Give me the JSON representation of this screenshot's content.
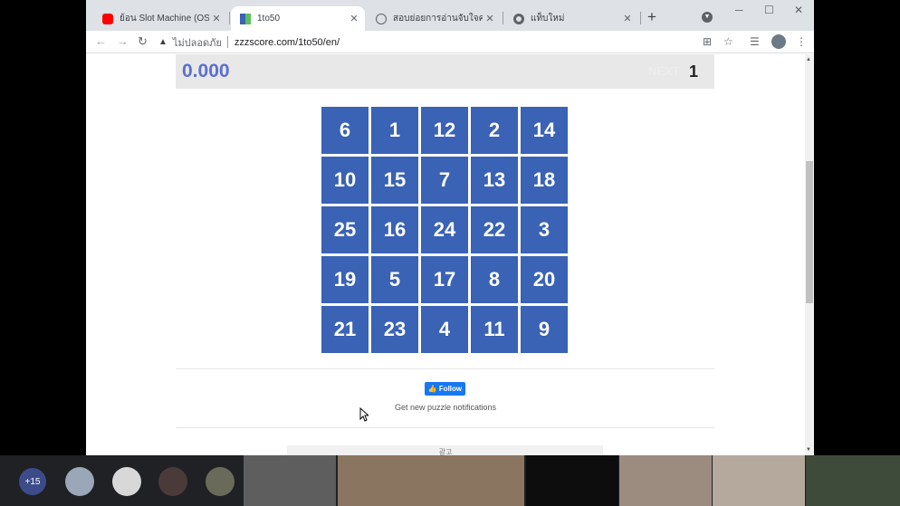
{
  "tabs": [
    {
      "title": "ย้อน Slot Machine (OST. Ho",
      "favicon": "youtube-icon",
      "active": false
    },
    {
      "title": "1to50",
      "favicon": "1to50-icon",
      "active": true
    },
    {
      "title": "สอบย่อยการอ่านจับใจความ ชุด",
      "favicon": "globe-icon",
      "active": false
    },
    {
      "title": "แท็บใหม่",
      "favicon": "chrome-icon",
      "active": false
    }
  ],
  "address": {
    "security_label": "ไม่ปลอดภัย",
    "url": "zzzscore.com/1to50/en/"
  },
  "game": {
    "timer": "0.000",
    "next_label": "NEXT",
    "next_value": "1",
    "grid": [
      "6",
      "1",
      "12",
      "2",
      "14",
      "10",
      "15",
      "7",
      "13",
      "18",
      "25",
      "16",
      "24",
      "22",
      "3",
      "19",
      "5",
      "17",
      "8",
      "20",
      "21",
      "23",
      "4",
      "11",
      "9"
    ]
  },
  "social": {
    "follow_label": "Follow",
    "notification_text": "Get new puzzle notifications"
  },
  "ad": {
    "label": "광고"
  },
  "meeting": {
    "overflow_count": "+15"
  },
  "colors": {
    "tile": "#3a62b5",
    "timer": "#5b6fd0",
    "follow": "#1877f2"
  }
}
